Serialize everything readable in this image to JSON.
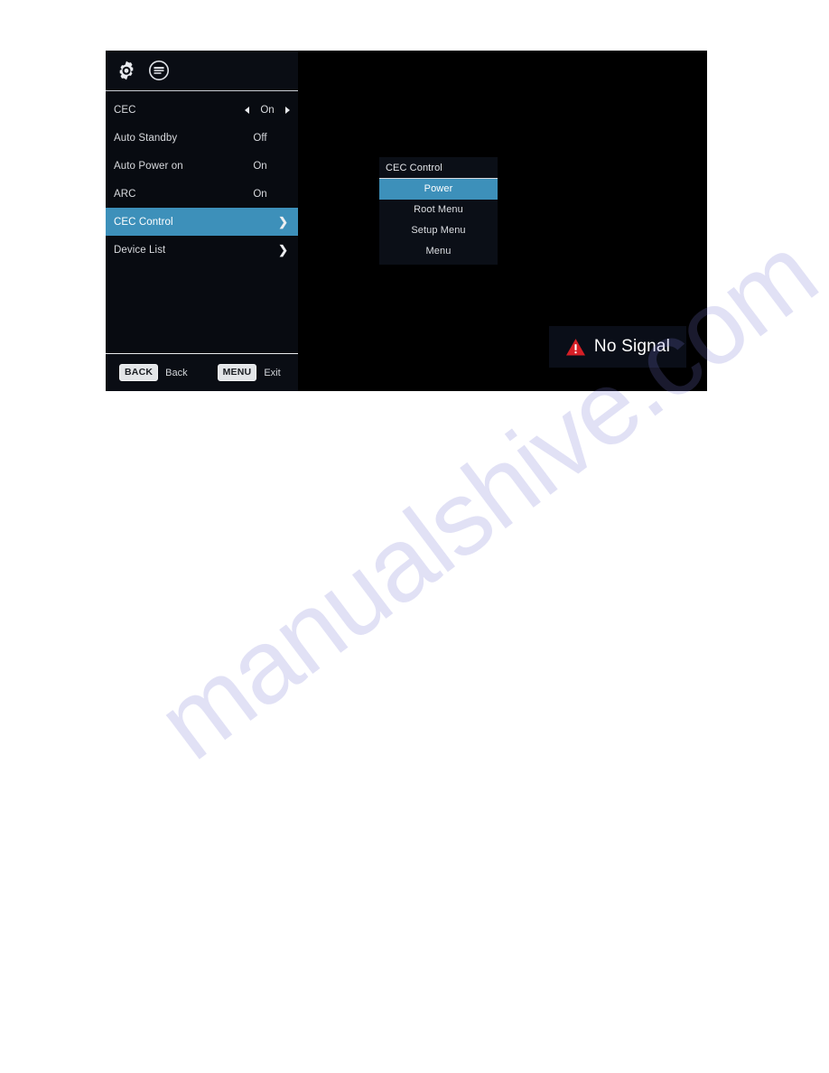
{
  "page": {
    "watermark": "manualshive.com"
  },
  "osd": {
    "header": {
      "icons": [
        {
          "name": "settings-gear-icon",
          "label": "Settings"
        },
        {
          "name": "menu-list-circle-icon",
          "label": "Menu"
        }
      ]
    },
    "menu_items": [
      {
        "label": "CEC",
        "value": "On",
        "type": "spinner",
        "selected": false
      },
      {
        "label": "Auto Standby",
        "value": "Off",
        "type": "value",
        "selected": false
      },
      {
        "label": "Auto Power on",
        "value": "On",
        "type": "value",
        "selected": false
      },
      {
        "label": "ARC",
        "value": "On",
        "type": "value",
        "selected": false
      },
      {
        "label": "CEC Control",
        "value": "",
        "type": "submenu",
        "selected": true
      },
      {
        "label": "Device List",
        "value": "",
        "type": "submenu",
        "selected": false
      }
    ],
    "footer": {
      "back_key": "BACK",
      "back_caption": "Back",
      "menu_key": "MENU",
      "menu_caption": "Exit"
    },
    "popup": {
      "title": "CEC Control",
      "items": [
        {
          "label": "Power",
          "selected": true
        },
        {
          "label": "Root Menu",
          "selected": false
        },
        {
          "label": "Setup Menu",
          "selected": false
        },
        {
          "label": "Menu",
          "selected": false
        }
      ]
    },
    "no_signal": {
      "text": "No Signal",
      "icon": "warning-triangle-icon"
    },
    "colors": {
      "accent_blue": "#3d90ba",
      "panel_background": "#080b11",
      "video_background": "#000000",
      "popup_background": "#0b0f17",
      "warning_red": "#d61f26",
      "text_primary": "#d8dade",
      "watermark": "#7878d2"
    }
  }
}
